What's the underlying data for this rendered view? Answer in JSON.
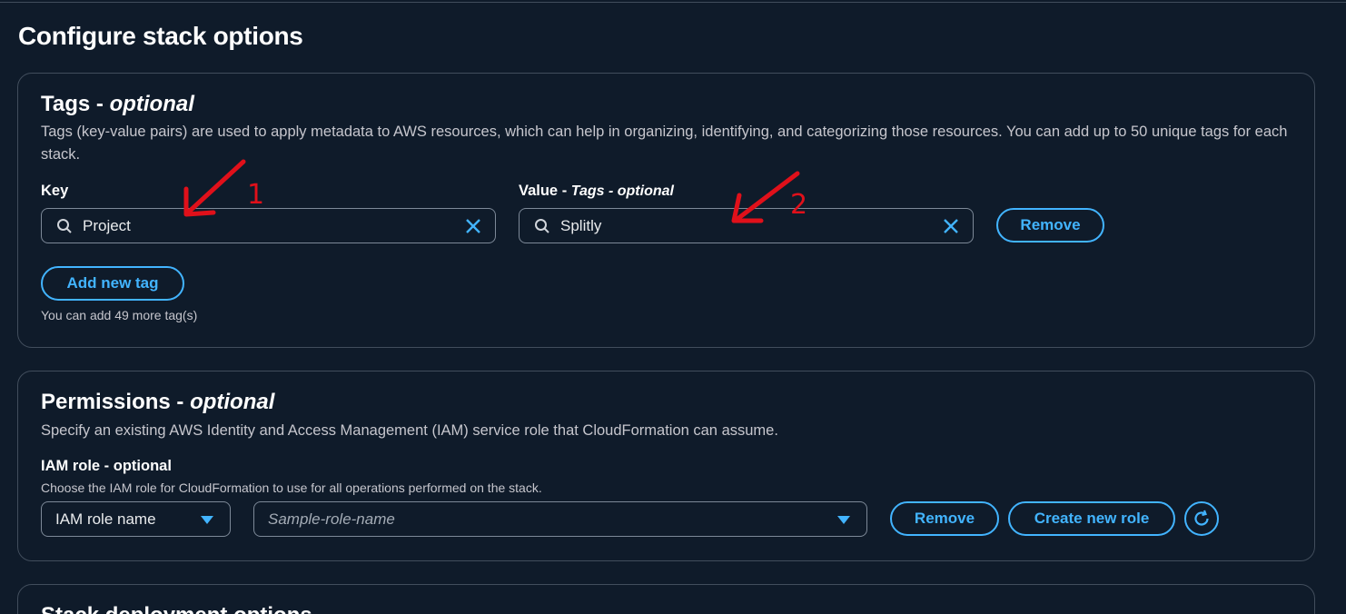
{
  "page_title": "Configure stack options",
  "tags": {
    "title": "Tags - ",
    "title_optional": "optional",
    "description": "Tags (key-value pairs) are used to apply metadata to AWS resources, which can help in organizing, identifying, and categorizing those resources. You can add up to 50 unique tags for each stack.",
    "key_label": "Key",
    "value_label": "Value - ",
    "value_label_optional": "Tags - optional",
    "key_value": "Project",
    "value_value": "Splitly",
    "remove_label": "Remove",
    "add_label": "Add new tag",
    "limit_hint": "You can add 49 more tag(s)"
  },
  "permissions": {
    "title": "Permissions - ",
    "title_optional": "optional",
    "description": "Specify an existing AWS Identity and Access Management (IAM) service role that CloudFormation can assume.",
    "iam_label": "IAM role - optional",
    "iam_hint": "Choose the IAM role for CloudFormation to use for all operations performed on the stack.",
    "role_type_selected": "IAM role name",
    "role_name_placeholder": "Sample-role-name",
    "remove_label": "Remove",
    "create_label": "Create new role"
  },
  "stack_deployment": {
    "title": "Stack deployment options"
  },
  "annotations": [
    "1",
    "2"
  ],
  "colors": {
    "accent": "#42b4ff",
    "annotation": "#e0101a",
    "background": "#0f1b2a",
    "border": "#414d5c"
  }
}
